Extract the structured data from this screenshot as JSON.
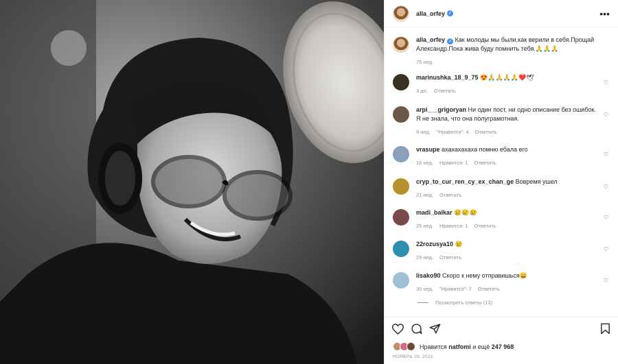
{
  "post": {
    "username": "alla_orfey",
    "more_icon": "more-dots-icon",
    "caption_user": "alla_orfey",
    "caption_text": "Как молоды мы были,как верили в себя.Прощай Александр.Пока жива буду помнить тебя.🙏🙏🙏",
    "caption_time": "75 нед."
  },
  "comments": [
    {
      "user": "marinushka_18_9_75",
      "text": "😍🙏🙏🙏🙏❤️🕊",
      "time": "3 дн.",
      "likes": "",
      "reply": "Ответить",
      "avatar_color": "#3a2f24"
    },
    {
      "user": "arpi___grigoryan",
      "text": "Ни один пост, ни одно описание без ошибок. Я не знала, что она полуграмотная.",
      "time": "9 нед.",
      "likes": "\"Нравится\": 4",
      "reply": "Ответить",
      "avatar_color": "#6b5a4a"
    },
    {
      "user": "vrasupe",
      "text": "ахахахахаха помню ебала его",
      "time": "16 нед.",
      "likes": "Нравится: 1",
      "reply": "Ответить",
      "avatar_color": "#8aa0b8"
    },
    {
      "user": "cryp_to_cur_ren_cy_ex_chan_ge",
      "text": "Вовремя ушел",
      "time": "21 нед.",
      "likes": "",
      "reply": "Ответить",
      "avatar_color": "#b8912e"
    },
    {
      "user": "madi_balkar",
      "text": "😢😢😢",
      "time": "25 нед.",
      "likes": "Нравится: 1",
      "reply": "Ответить",
      "avatar_color": "#7a4a4a"
    },
    {
      "user": "22rozusya10",
      "text": "😢",
      "time": "29 нед.",
      "likes": "",
      "reply": "Ответить",
      "avatar_color": "#2f8fb0"
    },
    {
      "user": "lisako90",
      "text": "Скоро к нему отправишься😄",
      "time": "30 нед.",
      "likes": "\"Нравится\": 7",
      "reply": "Ответить",
      "avatar_color": "#9fc1d6"
    }
  ],
  "view_replies": "Посмотреть ответы (13)",
  "actions": {
    "like_icon": "heart-icon",
    "comment_icon": "comment-icon",
    "share_icon": "share-icon",
    "save_icon": "bookmark-icon"
  },
  "likes": {
    "prefix": "Нравится",
    "user": "natfomi",
    "suffix": "и ещё",
    "count": "247 968"
  },
  "date": "НОЯБРЬ 28, 2021",
  "colors": {
    "link": "#3897f0",
    "muted": "#8e8e8e",
    "text": "#262626"
  }
}
